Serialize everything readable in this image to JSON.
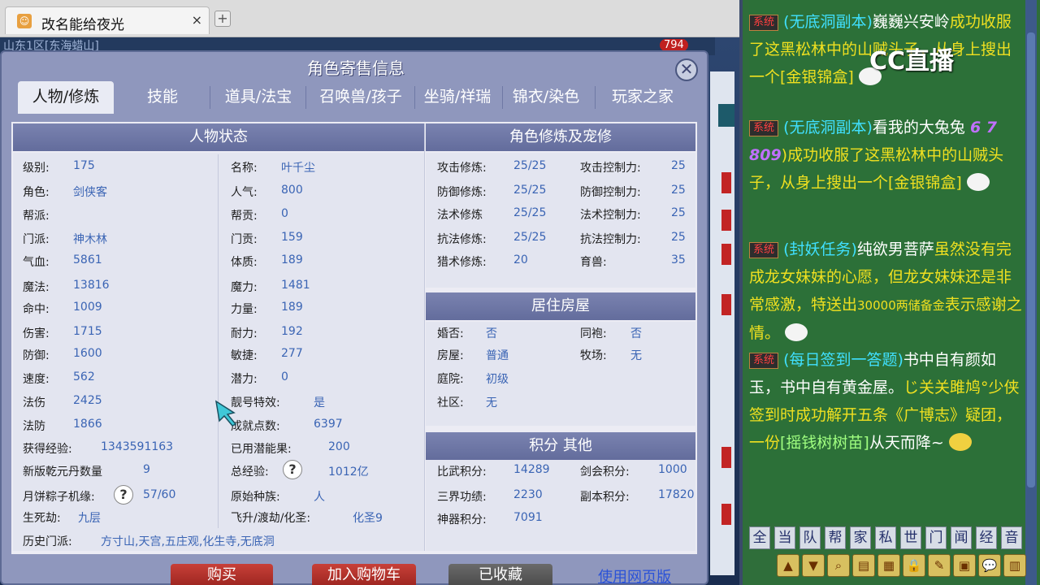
{
  "browser": {
    "tab_title": "改名能给夜光",
    "tab_close": "×",
    "new_tab": "+"
  },
  "game": {
    "topbar_text": "山东1区[东海蜡山]",
    "badge": "794"
  },
  "dialog": {
    "title": "角色寄售信息",
    "close": "✕",
    "tabs": [
      "人物/修炼",
      "技能",
      "道具/法宝",
      "召唤兽/孩子",
      "坐骑/祥瑞",
      "锦衣/染色",
      "玩家之家"
    ],
    "status_panel": {
      "title": "人物状态",
      "left": [
        {
          "label": "级别:",
          "value": "175"
        },
        {
          "label": "角色:",
          "value": "剑侠客"
        },
        {
          "label": "帮派:",
          "value": ""
        },
        {
          "label": "门派:",
          "value": "神木林"
        },
        {
          "label": "气血:",
          "value": "5861"
        },
        {
          "label": "魔法:",
          "value": "13816"
        },
        {
          "label": "命中:",
          "value": "1009"
        },
        {
          "label": "伤害:",
          "value": "1715"
        },
        {
          "label": "防御:",
          "value": "1600"
        },
        {
          "label": "速度:",
          "value": "562"
        },
        {
          "label": "法伤",
          "value": "2425"
        },
        {
          "label": "法防",
          "value": "1866"
        }
      ],
      "right": [
        {
          "label": "名称:",
          "value": "叶千尘"
        },
        {
          "label": "人气:",
          "value": "800"
        },
        {
          "label": "帮贡:",
          "value": "0"
        },
        {
          "label": "门贡:",
          "value": "159"
        },
        {
          "label": "体质:",
          "value": "189"
        },
        {
          "label": "魔力:",
          "value": "1481"
        },
        {
          "label": "力量:",
          "value": "189"
        },
        {
          "label": "耐力:",
          "value": "192"
        },
        {
          "label": "敏捷:",
          "value": "277"
        },
        {
          "label": "潜力:",
          "value": "0"
        },
        {
          "label": "靓号特效:",
          "value": "是"
        },
        {
          "label": "成就点数:",
          "value": "6397"
        }
      ],
      "extra": {
        "exp_label": "获得经验:",
        "exp_value": "1343591163",
        "potion_label": "已用潜能果:",
        "potion_value": "200",
        "qiankun_label": "新版乾元丹数量",
        "qiankun_value": "9",
        "total_exp_label": "总经验:",
        "total_exp_value": "1012亿",
        "zongzi_label": "月饼粽子机缘:",
        "zongzi_value": "57/60",
        "race_label": "原始种族:",
        "race_value": "人",
        "shengsi_label": "生死劫:",
        "shengsi_value": "九层",
        "feisheng_label": "飞升/渡劫/化圣:",
        "feisheng_value": "化圣9",
        "history_label": "历史门派:",
        "history_value": "方寸山,天宫,五庄观,化生寺,无底洞",
        "help_icon": "?"
      }
    },
    "cultivation_panel": {
      "title": "角色修炼及宠修",
      "left": [
        {
          "label": "攻击修炼:",
          "value": "25/25"
        },
        {
          "label": "防御修炼:",
          "value": "25/25"
        },
        {
          "label": "法术修炼",
          "value": "25/25"
        },
        {
          "label": "抗法修炼:",
          "value": "25/25"
        },
        {
          "label": "猎术修炼:",
          "value": "20"
        }
      ],
      "right": [
        {
          "label": "攻击控制力:",
          "value": "25"
        },
        {
          "label": "防御控制力:",
          "value": "25"
        },
        {
          "label": "法术控制力:",
          "value": "25"
        },
        {
          "label": "抗法控制力:",
          "value": "25"
        },
        {
          "label": "育兽:",
          "value": "35"
        }
      ]
    },
    "house_panel": {
      "title": "居住房屋",
      "left": [
        {
          "label": "婚否:",
          "value": "否"
        },
        {
          "label": "房屋:",
          "value": "普通"
        },
        {
          "label": "庭院:",
          "value": "初级"
        },
        {
          "label": "社区:",
          "value": "无"
        }
      ],
      "right": [
        {
          "label": "同袍:",
          "value": "否"
        },
        {
          "label": "牧场:",
          "value": "无"
        }
      ]
    },
    "score_panel": {
      "title": "积分 其他",
      "left": [
        {
          "label": "比武积分:",
          "value": "14289"
        },
        {
          "label": "三界功绩:",
          "value": "2230"
        },
        {
          "label": "神器积分:",
          "value": "7091"
        }
      ],
      "right": [
        {
          "label": "剑会积分:",
          "value": "1000"
        },
        {
          "label": "副本积分:",
          "value": "17820"
        }
      ]
    },
    "buttons": {
      "buy": "购买",
      "add_cart": "加入购物车",
      "collected": "已收藏",
      "web_version": "使用网页版"
    }
  },
  "chat": {
    "logo": "CC直播",
    "sys_tag": "系统",
    "messages": [
      {
        "a": "(无底洞副本)",
        "b": "巍巍兴安岭",
        "c": "成功收服了这黑松林中的山贼头子，从身上搜出一个",
        "d": "[金银锦盒]"
      },
      {
        "a": "(无底洞副本)",
        "b": "看我的大兔兔",
        "num": "6 7 809",
        "c": ")成功收服了这黑松林中的山贼头子，从身上搜出一个",
        "d": "[金银锦盒]"
      },
      {
        "a": "(封妖任务)",
        "b": "纯欲男菩萨",
        "c": "虽然没有完成龙女妹妹的心愿，但龙女妹妹还是非常感激，特送出",
        "d": "30000两储备金",
        "e": "表示感谢之情。"
      },
      {
        "a": "(每日签到一答题)",
        "b": "书中自有颜如玉，书中自有黄金屋。",
        "name": "じ关关雎鸠°",
        "c": "少侠签到时成功解开五条《广博志》疑团，一份",
        "d": "[摇钱树树苗]",
        "e": "从天而降~"
      }
    ],
    "channels": [
      "全",
      "当",
      "队",
      "帮",
      "家",
      "私",
      "世",
      "门",
      "闻",
      "经",
      "音"
    ],
    "tools": [
      "▲",
      "▼",
      "⌕",
      "▤",
      "▦",
      "🔒",
      "✎",
      "▣",
      "💬",
      "▥"
    ]
  }
}
